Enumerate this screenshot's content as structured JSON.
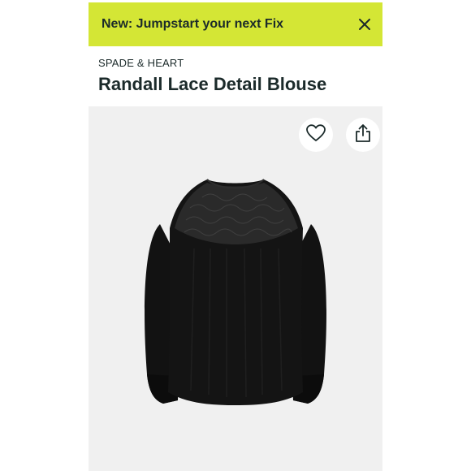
{
  "banner": {
    "text": "New: Jumpstart your next Fix",
    "background": "#d4e635"
  },
  "product": {
    "brand": "SPADE & HEART",
    "title": "Randall Lace Detail Blouse",
    "image_icon": "black-lace-blouse-image",
    "image_background": "#f0f0f0"
  },
  "actions": {
    "favorite_icon": "heart-icon",
    "share_icon": "share-icon"
  }
}
